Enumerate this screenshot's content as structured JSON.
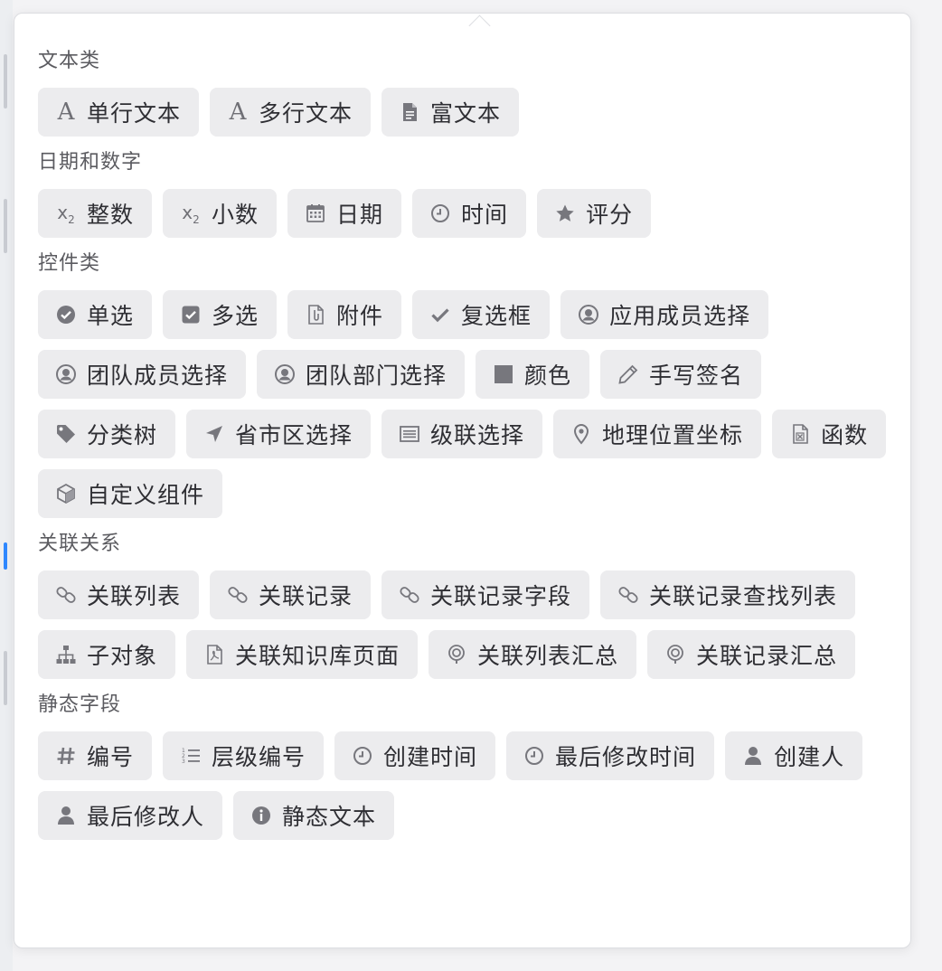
{
  "sections": [
    {
      "title": "文本类",
      "items": [
        {
          "label": "单行文本",
          "icon": "letter-a-icon"
        },
        {
          "label": "多行文本",
          "icon": "letter-a-icon"
        },
        {
          "label": "富文本",
          "icon": "document-icon"
        }
      ]
    },
    {
      "title": "日期和数字",
      "items": [
        {
          "label": "整数",
          "icon": "subscript-x-icon"
        },
        {
          "label": "小数",
          "icon": "subscript-x-icon"
        },
        {
          "label": "日期",
          "icon": "calendar-icon"
        },
        {
          "label": "时间",
          "icon": "clock-icon"
        },
        {
          "label": "评分",
          "icon": "star-icon"
        }
      ]
    },
    {
      "title": "控件类",
      "items": [
        {
          "label": "单选",
          "icon": "radio-check-icon"
        },
        {
          "label": "多选",
          "icon": "checkbox-icon"
        },
        {
          "label": "附件",
          "icon": "attachment-file-icon"
        },
        {
          "label": "复选框",
          "icon": "checkmark-icon"
        },
        {
          "label": "应用成员选择",
          "icon": "user-circle-icon"
        },
        {
          "label": "团队成员选择",
          "icon": "user-circle-icon"
        },
        {
          "label": "团队部门选择",
          "icon": "user-circle-icon"
        },
        {
          "label": "颜色",
          "icon": "color-square-icon"
        },
        {
          "label": "手写签名",
          "icon": "pencil-icon"
        },
        {
          "label": "分类树",
          "icon": "tag-icon"
        },
        {
          "label": "省市区选择",
          "icon": "location-arrow-icon"
        },
        {
          "label": "级联选择",
          "icon": "list-box-icon"
        },
        {
          "label": "地理位置坐标",
          "icon": "map-pin-icon"
        },
        {
          "label": "函数",
          "icon": "function-file-icon"
        },
        {
          "label": "自定义组件",
          "icon": "cube-icon"
        }
      ]
    },
    {
      "title": "关联关系",
      "items": [
        {
          "label": "关联列表",
          "icon": "link-icon"
        },
        {
          "label": "关联记录",
          "icon": "link-icon"
        },
        {
          "label": "关联记录字段",
          "icon": "link-icon"
        },
        {
          "label": "关联记录查找列表",
          "icon": "link-icon"
        },
        {
          "label": "子对象",
          "icon": "hierarchy-icon"
        },
        {
          "label": "关联知识库页面",
          "icon": "pdf-file-icon"
        },
        {
          "label": "关联列表汇总",
          "icon": "aggregate-pin-icon"
        },
        {
          "label": "关联记录汇总",
          "icon": "aggregate-pin-icon"
        }
      ]
    },
    {
      "title": "静态字段",
      "items": [
        {
          "label": "编号",
          "icon": "hash-icon"
        },
        {
          "label": "层级编号",
          "icon": "numbered-list-icon"
        },
        {
          "label": "创建时间",
          "icon": "clock-icon"
        },
        {
          "label": "最后修改时间",
          "icon": "clock-icon"
        },
        {
          "label": "创建人",
          "icon": "person-icon"
        },
        {
          "label": "最后修改人",
          "icon": "person-icon"
        },
        {
          "label": "静态文本",
          "icon": "info-icon"
        }
      ]
    }
  ]
}
